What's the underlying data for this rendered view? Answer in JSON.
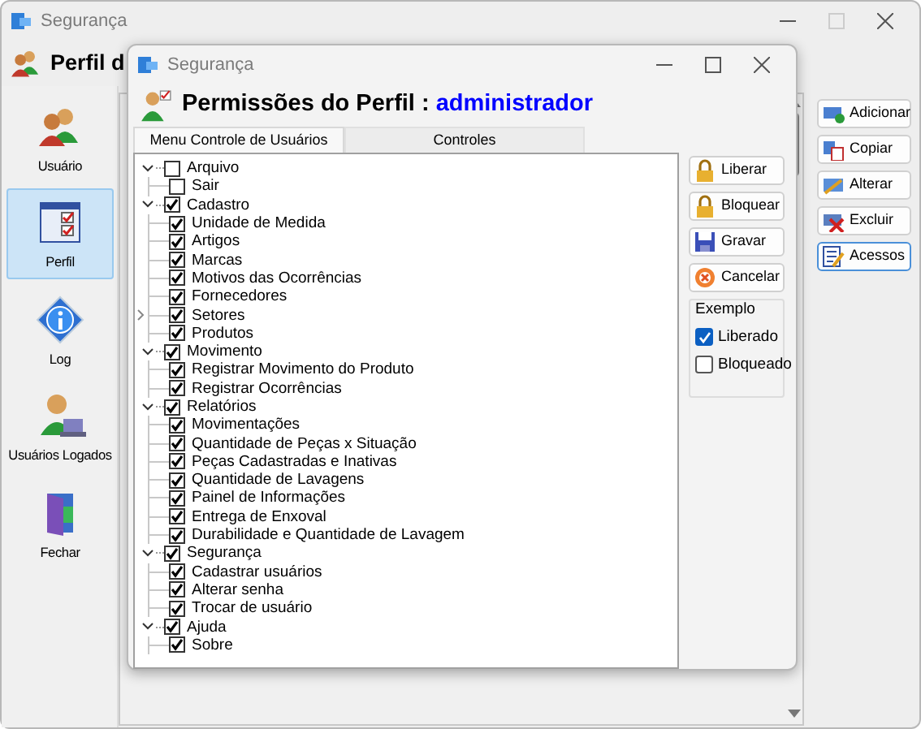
{
  "main_window": {
    "title": "Segurança",
    "header": "Perfil d",
    "sidebar": [
      {
        "label": "Usuário",
        "selected": false
      },
      {
        "label": "Perfil",
        "selected": true
      },
      {
        "label": "Log",
        "selected": false
      },
      {
        "label": "Usuários Logados",
        "selected": false
      },
      {
        "label": "Fechar",
        "selected": false
      }
    ],
    "actions": [
      {
        "label": "Adicionar",
        "focused": false
      },
      {
        "label": "Copiar",
        "focused": false
      },
      {
        "label": "Alterar",
        "focused": false
      },
      {
        "label": "Excluir",
        "focused": false
      },
      {
        "label": "Acessos",
        "focused": true
      }
    ]
  },
  "dialog": {
    "title": "Segurança",
    "heading": "Permissões do Perfil : ",
    "profile": "administrador",
    "tabs": [
      {
        "label": "Menu Controle de Usuários",
        "selected": true
      },
      {
        "label": "Controles",
        "selected": false
      }
    ],
    "tree": [
      {
        "label": "Arquivo",
        "checked": false,
        "expanded": true,
        "children": [
          {
            "label": "Sair",
            "checked": false
          }
        ]
      },
      {
        "label": "Cadastro",
        "checked": true,
        "expanded": true,
        "children": [
          {
            "label": "Unidade de Medida",
            "checked": true
          },
          {
            "label": "Artigos",
            "checked": true
          },
          {
            "label": "Marcas",
            "checked": true
          },
          {
            "label": "Motivos das Ocorrências",
            "checked": true
          },
          {
            "label": "Fornecedores",
            "checked": true
          },
          {
            "label": "Setores",
            "checked": true,
            "expanded": false
          },
          {
            "label": "Produtos",
            "checked": true
          }
        ]
      },
      {
        "label": "Movimento",
        "checked": true,
        "expanded": true,
        "children": [
          {
            "label": "Registrar Movimento do Produto",
            "checked": true
          },
          {
            "label": "Registrar Ocorrências",
            "checked": true
          }
        ]
      },
      {
        "label": "Relatórios",
        "checked": true,
        "expanded": true,
        "children": [
          {
            "label": "Movimentações",
            "checked": true
          },
          {
            "label": "Quantidade de Peças x Situação",
            "checked": true
          },
          {
            "label": "Peças Cadastradas e Inativas",
            "checked": true
          },
          {
            "label": "Quantidade de Lavagens",
            "checked": true
          },
          {
            "label": "Painel de Informações",
            "checked": true
          },
          {
            "label": "Entrega de Enxoval",
            "checked": true
          },
          {
            "label": "Durabilidade e Quantidade de Lavagem",
            "checked": true
          }
        ]
      },
      {
        "label": "Segurança",
        "checked": true,
        "expanded": true,
        "children": [
          {
            "label": "Cadastrar usuários",
            "checked": true
          },
          {
            "label": "Alterar senha",
            "checked": true
          },
          {
            "label": "Trocar de usuário",
            "checked": true
          }
        ]
      },
      {
        "label": "Ajuda",
        "checked": true,
        "expanded": true,
        "children": [
          {
            "label": "Sobre",
            "checked": true
          }
        ]
      }
    ],
    "buttons": [
      {
        "label": "Liberar"
      },
      {
        "label": "Bloquear"
      },
      {
        "label": "Gravar"
      },
      {
        "label": "Cancelar"
      }
    ],
    "legend": {
      "title": "Exemplo",
      "items": [
        {
          "label": "Liberado",
          "checked": true
        },
        {
          "label": "Bloqueado",
          "checked": false
        }
      ]
    }
  }
}
